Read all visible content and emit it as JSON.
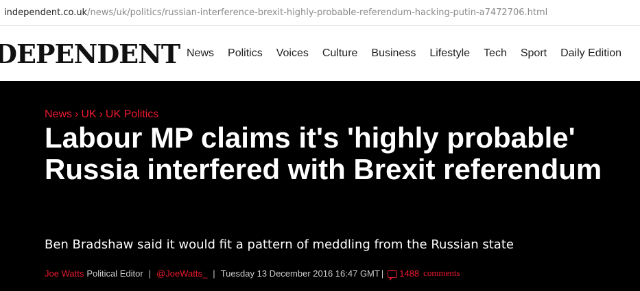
{
  "browser": {
    "url_domain": "independent.co.uk",
    "url_path": "/news/uk/politics/russian-interference-brexit-highly-probable-referendum-hacking-putin-a7472706.html"
  },
  "masthead": {
    "brand": "DEPENDENT",
    "nav": [
      "News",
      "Politics",
      "Voices",
      "Culture",
      "Business",
      "Lifestyle",
      "Tech",
      "Sport",
      "Daily Edition"
    ]
  },
  "article": {
    "breadcrumb": [
      "News",
      "UK",
      "UK Politics"
    ],
    "breadcrumb_separator": "›",
    "headline": "Labour MP claims it's 'highly probable' Russia interfered with Brexit referendum",
    "standfirst": "Ben Bradshaw said it would fit a pattern of meddling from the Russian state",
    "byline": {
      "author": "Joe Watts",
      "role": "Political Editor",
      "separator": "|",
      "twitter": "@JoeWatts_",
      "date": "Tuesday 13 December 2016 16:47 GMT",
      "comment_count": "1488",
      "comments_label": "comments"
    }
  },
  "colors": {
    "accent": "#ec1a2e",
    "background": "#000000",
    "headline": "#ffffff"
  }
}
